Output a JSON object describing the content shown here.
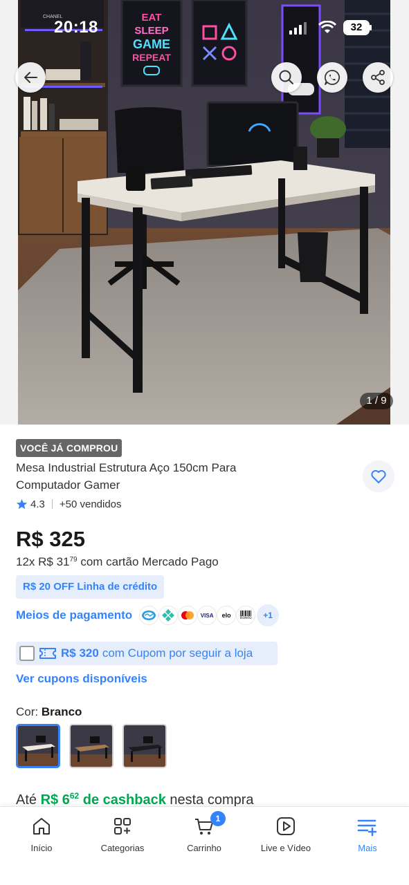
{
  "status_bar": {
    "time": "20:18",
    "battery": "32"
  },
  "hero": {
    "image_counter": "1 / 9",
    "poster_left_text": [
      "EAT",
      "SLEEP",
      "GAME",
      "REPEAT"
    ],
    "book_spine_text": "CHANEL",
    "icons": {
      "back": "back-arrow-icon",
      "search": "search-icon",
      "whatsapp": "whatsapp-icon",
      "share": "share-icon"
    }
  },
  "product": {
    "badge": "VOCÊ JÁ COMPROU",
    "title": "Mesa Industrial Estrutura Aço 150cm Para Computador Gamer",
    "rating": "4.3",
    "sold": "+50 vendidos",
    "price": "R$ 325",
    "installments_prefix": "12x R$ 31",
    "installments_cents": "79",
    "installments_suffix": " com cartão Mercado Pago",
    "credit_offer": "R$ 20 OFF Linha de crédito",
    "payment_link": "Meios de pagamento",
    "payment_logos": [
      {
        "name": "mercado-pago",
        "label": ""
      },
      {
        "name": "pix",
        "label": ""
      },
      {
        "name": "mastercard",
        "label": ""
      },
      {
        "name": "visa",
        "label": "VISA"
      },
      {
        "name": "elo",
        "label": "elo"
      },
      {
        "name": "boleto",
        "label": "Boleto"
      }
    ],
    "payment_more": "+1",
    "coupon_amount": "R$ 320",
    "coupon_text": "com Cupom por seguir a loja",
    "coupons_link": "Ver cupons disponíveis",
    "color_prefix": "Cor: ",
    "color_value": "Branco",
    "cashback_prefix": "Até ",
    "cashback_amount": "R$ 6",
    "cashback_cents": "62",
    "cashback_mid": " de cashback",
    "cashback_suffix": " nesta compra"
  },
  "nav": {
    "items": [
      {
        "label": "Início",
        "icon": "home-icon"
      },
      {
        "label": "Categorias",
        "icon": "categories-icon"
      },
      {
        "label": "Carrinho",
        "icon": "cart-icon",
        "badge": "1"
      },
      {
        "label": "Live e Vídeo",
        "icon": "play-icon"
      },
      {
        "label": "Mais",
        "icon": "menu-plus-icon"
      }
    ]
  },
  "colors": {
    "accent": "#3483fa",
    "cashback_green": "#00a650",
    "badge_gray": "#666666",
    "coupon_bg": "#e6eefb"
  }
}
